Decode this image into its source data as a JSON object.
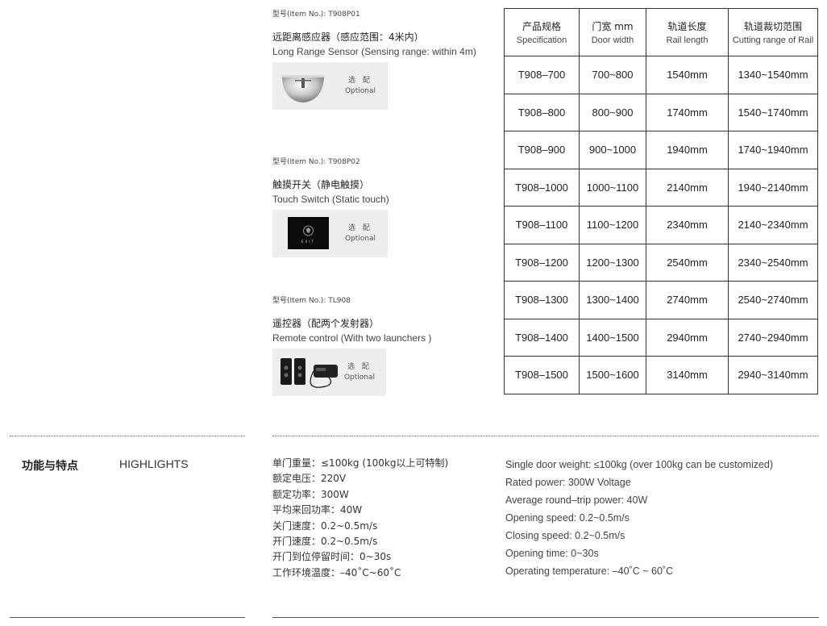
{
  "items": [
    {
      "item_no": "型号(Item No.): T908P01",
      "name_cn": "远距离感应器（感应范围：4米内）",
      "name_en": "Long Range Sensor (Sensing range: within 4m)",
      "optional_cn": "选 配",
      "optional_en": "Optional"
    },
    {
      "item_no": "型号(Item No.): T908P02",
      "name_cn": "触摸开关（静电触摸）",
      "name_en": "Touch Switch (Static touch)",
      "optional_cn": "选 配",
      "optional_en": "Optional",
      "switch_text": "EXIT"
    },
    {
      "item_no": "型号(Item No.): TL908",
      "name_cn": "遥控器（配两个发射器）",
      "name_en": "Remote control (With two launchers )",
      "optional_cn": "选 配",
      "optional_en": "Optional"
    }
  ],
  "spec_table": {
    "headers": [
      {
        "cn": "产品规格",
        "en": "Specification"
      },
      {
        "cn": "门宽 mm",
        "en": "Door width"
      },
      {
        "cn": "轨道长度",
        "en": "Rail length"
      },
      {
        "cn": "轨道裁切范围",
        "en": "Cutting range of Rail"
      }
    ],
    "rows": [
      [
        "T908–700",
        "700~800",
        "1540mm",
        "1340~1540mm"
      ],
      [
        "T908–800",
        "800~900",
        "1740mm",
        "1540~1740mm"
      ],
      [
        "T908–900",
        "900~1000",
        "1940mm",
        "1740~1940mm"
      ],
      [
        "T908–1000",
        "1000~1100",
        "2140mm",
        "1940~2140mm"
      ],
      [
        "T908–1100",
        "1100~1200",
        "2340mm",
        "2140~2340mm"
      ],
      [
        "T908–1200",
        "1200~1300",
        "2540mm",
        "2340~2540mm"
      ],
      [
        "T908–1300",
        "1300~1400",
        "2740mm",
        "2540~2740mm"
      ],
      [
        "T908–1400",
        "1400~1500",
        "2940mm",
        "2740~2940mm"
      ],
      [
        "T908–1500",
        "1500~1600",
        "3140mm",
        "2940~3140mm"
      ]
    ]
  },
  "highlights": {
    "title_cn": "功能与特点",
    "title_en": "HIGHLIGHTS",
    "features_cn": [
      "单门重量：≤100kg (100kg以上可特制)",
      "额定电压：220V",
      "额定功率：300W",
      "平均来回功率：40W",
      "关门速度：0.2~0.5m/s",
      "开门速度：0.2~0.5m/s",
      "开门到位停留时间：0~30s",
      "工作环境温度：–40˚C~60˚C"
    ],
    "features_en": [
      "Single door weight: ≤100kg (over 100kg can be customized)",
      "Rated power: 300W Voltage",
      "Average round–trip power: 40W",
      "Opening speed: 0.2~0.5m/s",
      "Closing speed: 0.2~0.5m/s",
      "Opening time: 0~30s",
      "Operating temperature: –40˚C ~ 60˚C"
    ]
  }
}
